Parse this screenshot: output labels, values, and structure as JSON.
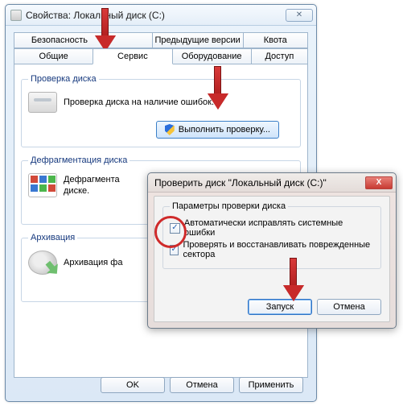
{
  "main_window": {
    "title": "Свойства: Локальный диск (C:)",
    "tabs_row1": [
      "Безопасность",
      "",
      "Предыдущие версии",
      "Квота"
    ],
    "tabs_row2": [
      "Общие",
      "Сервис",
      "Оборудование",
      "Доступ"
    ],
    "active_tab": "Сервис",
    "group_check": {
      "legend": "Проверка диска",
      "desc": "Проверка диска на наличие ошибок.",
      "button": "Выполнить проверку..."
    },
    "group_defrag": {
      "legend": "Дефрагментация диска",
      "desc": "Дефрагмента\nдиске."
    },
    "group_archive": {
      "legend": "Архивация",
      "desc": "Архивация фа"
    },
    "buttons": {
      "ok": "OK",
      "cancel": "Отмена",
      "apply": "Применить"
    }
  },
  "dialog": {
    "title": "Проверить диск \"Локальный диск (C:)\"",
    "group_legend": "Параметры проверки диска",
    "opt1": "Автоматически исправлять системные ошибки",
    "opt2": "Проверять и восстанавливать поврежденные сектора",
    "opt1_checked": true,
    "opt2_checked": true,
    "buttons": {
      "start": "Запуск",
      "cancel": "Отмена"
    }
  }
}
